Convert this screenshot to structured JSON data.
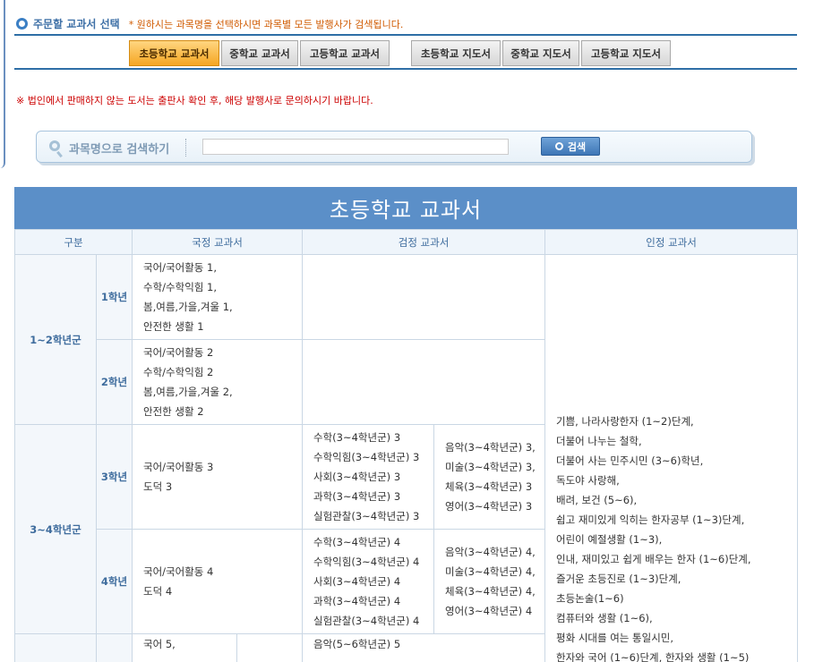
{
  "section": {
    "title": "주문할 교과서 선택",
    "note": "* 원하시는 과목명을 선택하시면 과목별 모든 발행사가 검색됩니다."
  },
  "tabs": [
    {
      "label": "초등학교 교과서",
      "active": true
    },
    {
      "label": "중학교 교과서",
      "active": false
    },
    {
      "label": "고등학교 교과서",
      "active": false
    },
    {
      "label": "초등학교 지도서",
      "active": false
    },
    {
      "label": "중학교 지도서",
      "active": false
    },
    {
      "label": "고등학교 지도서",
      "active": false
    }
  ],
  "warning": "※ 법인에서 판매하지 않는 도서는 출판사 확인 후, 해당 발행사로 문의하시기 바랍니다.",
  "search": {
    "label": "과목명으로 검색하기",
    "value": "",
    "button_label": "검색"
  },
  "table": {
    "banner": "초등학교 교과서",
    "headers": [
      "구분",
      "국정 교과서",
      "검정 교과서",
      "인정 교과서"
    ],
    "groups": [
      "1~2학년군",
      "3~4학년군"
    ],
    "grades": [
      "1학년",
      "2학년",
      "3학년",
      "4학년"
    ],
    "national": [
      [
        "국어/국어활동 1,",
        "수학/수학익힘 1,",
        "봄,여름,가을,겨울 1,",
        "안전한 생활 1"
      ],
      [
        "국어/국어활동 2",
        "수학/수학익힘 2",
        "봄,여름,가을,겨울 2,",
        "안전한 생활 2"
      ],
      [
        "국어/국어활동 3",
        "도덕 3"
      ],
      [
        "국어/국어활동 4",
        "도덕 4"
      ],
      [
        "국어 5,"
      ]
    ],
    "certified_a": [
      [],
      [],
      [
        "수학(3~4학년군) 3",
        "수학익힘(3~4학년군) 3",
        "사회(3~4학년군) 3",
        "과학(3~4학년군) 3",
        "실험관찰(3~4학년군) 3"
      ],
      [
        "수학(3~4학년군) 4",
        "수학익힘(3~4학년군) 4",
        "사회(3~4학년군) 4",
        "과학(3~4학년군) 4",
        "실험관찰(3~4학년군) 4"
      ],
      [
        "음악(5~6학년군) 5"
      ]
    ],
    "certified_b": [
      [],
      [],
      [
        "음악(3~4학년군) 3,",
        "미술(3~4학년군) 3,",
        "체육(3~4학년군) 3",
        "영어(3~4학년군) 3"
      ],
      [
        "음악(3~4학년군) 4,",
        "미술(3~4학년군) 4,",
        "체육(3~4학년군) 4,",
        "영어(3~4학년군) 4"
      ]
    ],
    "authorized": [
      "기쁨,    나라사랑한자 (1~2)단계,",
      "더불어 나누는 철학,",
      "더불어 사는 민주시민 (3~6)학년,",
      "독도야 사랑해,",
      "배려,    보건 (5~6),",
      "쉽고 재미있게 익히는 한자공부 (1~3)단계,",
      "어린이 예절생활 (1~3),",
      "인내,    재미있고 쉽게 배우는 한자 (1~6)단계,",
      "즐거운 초등진로 (1~3)단계,",
      "초등논술(1~6)",
      "컴퓨터와 생활 (1~6),",
      "평화 시대를 여는 통일시민,",
      "한자와 국어 (1~6)단계,    한자와 생활 (1~5)"
    ]
  }
}
